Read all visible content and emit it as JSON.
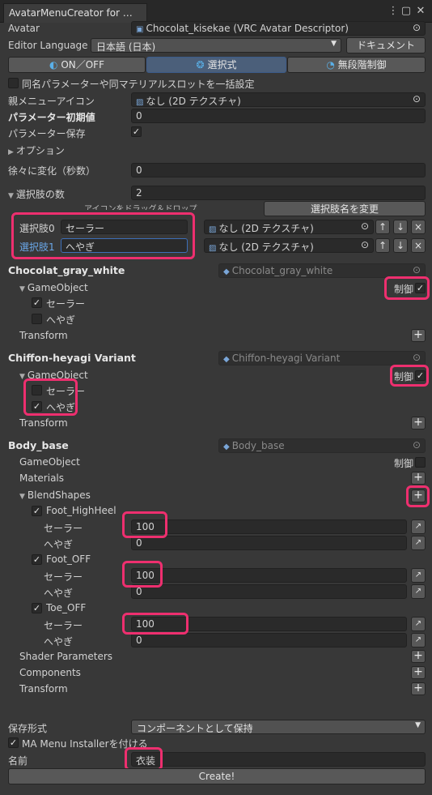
{
  "window": {
    "tab_title": "AvatarMenuCreator for …"
  },
  "header": {
    "avatar_label": "Avatar",
    "avatar_value": "Chocolat_kisekae (VRC Avatar Descriptor)",
    "editor_lang_label": "Editor Language",
    "editor_lang_value": "日本語 (日本)",
    "doc_button": "ドキュメント"
  },
  "modes": {
    "onoff": "ON／OFF",
    "choose": "選択式",
    "multi": "無段階制御"
  },
  "settings": {
    "same_name": "同名パラメーターや同マテリアルスロットを一括設定",
    "parent_icon_label": "親メニューアイコン",
    "parent_icon_value": "なし (2D テクスチャ)",
    "param_init_label": "パラメーター初期値",
    "param_init_value": "0",
    "param_save_label": "パラメーター保存",
    "options_label": "オプション",
    "gradual_label": "徐々に変化（秒数）",
    "gradual_value": "0",
    "choice_count_label": "選択肢の数",
    "choice_count_value": "2",
    "icon_drag_hint": "アイコンをドラッグ＆ドロップ",
    "rename_button": "選択肢名を変更"
  },
  "choices": [
    {
      "label": "選択肢0",
      "value": "セーラー",
      "icon": "なし (2D テクスチャ)"
    },
    {
      "label": "選択肢1",
      "value": "へやぎ",
      "icon": "なし (2D テクスチャ)"
    }
  ],
  "objects": [
    {
      "name": "Chocolat_gray_white",
      "ref": "Chocolat_gray_white"
    },
    {
      "name": "Chiffon-heyagi Variant",
      "ref": "Chiffon-heyagi Variant"
    },
    {
      "name": "Body_base",
      "ref": "Body_base"
    }
  ],
  "labels": {
    "gameobject": "GameObject",
    "transform": "Transform",
    "control": "制御",
    "sailor": "セーラー",
    "heyagi": "へやぎ",
    "materials": "Materials",
    "blendshapes": "BlendShapes",
    "shader_params": "Shader Parameters",
    "components": "Components"
  },
  "blendshapes": [
    {
      "name": "Foot_HighHeel",
      "sailor": "100",
      "heyagi": "0"
    },
    {
      "name": "Foot_OFF",
      "sailor": "100",
      "heyagi": "0"
    },
    {
      "name": "Toe_OFF",
      "sailor": "100",
      "heyagi": "0"
    }
  ],
  "footer": {
    "save_format_label": "保存形式",
    "save_format_value": "コンポーネントとして保持",
    "ma_installer": "MA Menu Installerを付ける",
    "name_label": "名前",
    "name_value": "衣装",
    "create_button": "Create!"
  },
  "colors": {
    "highlight": "#ee2f6f",
    "selected_tab": "#4b5f7a",
    "link_label": "#6aa7e8"
  }
}
